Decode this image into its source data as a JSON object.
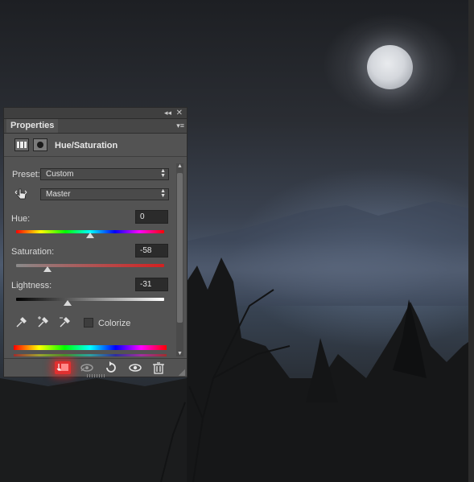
{
  "panel": {
    "tab_label": "Properties",
    "collapse_glyph": "◂◂",
    "close_glyph": "✕",
    "menu_glyph": "▾≡",
    "adjustment_title": "Hue/Saturation"
  },
  "controls": {
    "preset_label": "Preset:",
    "preset_value": "Custom",
    "channel_value": "Master",
    "hue": {
      "label": "Hue:",
      "value": "0",
      "position": 0.5
    },
    "saturation": {
      "label": "Saturation:",
      "value": "-58",
      "position": 0.21
    },
    "lightness": {
      "label": "Lightness:",
      "value": "-31",
      "position": 0.35
    },
    "colorize_label": "Colorize",
    "colorize_checked": false
  },
  "footer": {
    "icons": [
      "clip-to-layer-icon",
      "view-previous-state-icon",
      "reset-icon",
      "visibility-icon",
      "delete-icon"
    ]
  },
  "colors": {
    "panel_bg": "#535353",
    "clip_highlight": "#e03030"
  }
}
